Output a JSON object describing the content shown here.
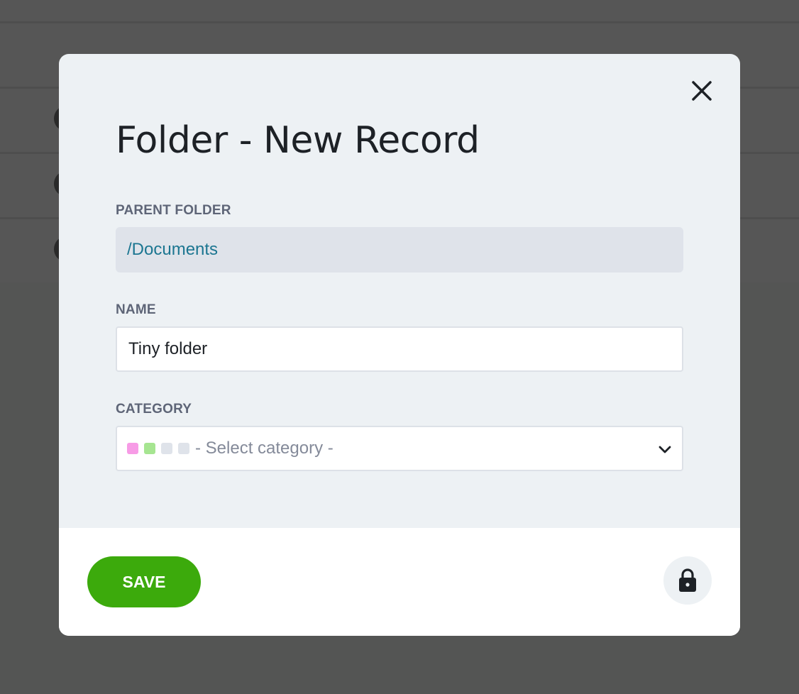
{
  "modal": {
    "title": "Folder - New Record",
    "close_icon": "close-icon",
    "fields": {
      "parent_folder": {
        "label": "PARENT FOLDER",
        "value": "/Documents"
      },
      "name": {
        "label": "NAME",
        "value": "Tiny folder"
      },
      "category": {
        "label": "CATEGORY",
        "placeholder": "- Select category -",
        "swatch_colors": [
          "#f79be6",
          "#a6e591",
          "#dfe3ea",
          "#dfe3ea"
        ]
      }
    },
    "footer": {
      "save_label": "SAVE",
      "lock_icon": "lock-icon"
    }
  },
  "colors": {
    "accent_save": "#3caa0c",
    "link_value": "#1c7691",
    "label": "#5e6577"
  }
}
